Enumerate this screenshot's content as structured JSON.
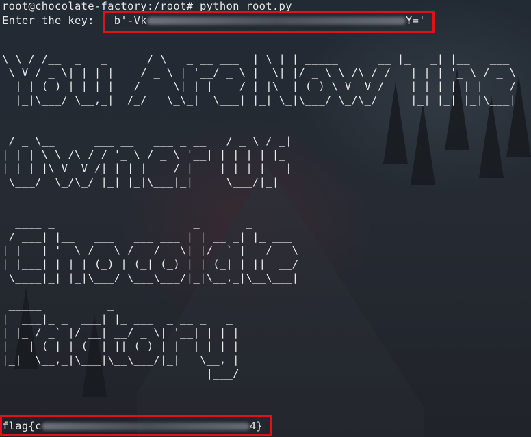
{
  "terminal": {
    "prompt": "root@chocolate-factory:/root# python root.py",
    "key_label": "Enter the key: ",
    "key_prefix": "b'-Vk",
    "key_suffix": "Y='",
    "banner_lines": [
      "__   __                 _               _   _                 _____ _          ",
      "\\ \\ / /__  _   _      / \\   _ __ ___  | \\ | | _____      __ |_   _| |__   ___ ",
      " \\ V / _ \\| | | |    / _ \\ | '__/ _ \\ |  \\| |/ _ \\ \\ /\\ / /   | | | '_ \\ / _ \\",
      "  | | (_) | |_| |   / ___ \\| | |  __/ | |\\  | (_) \\ V  V /    | | | | | |  __/",
      "  |_|\\___/ \\__,_|  /_/   \\_\\_|  \\___| |_| \\_|\\___/ \\_/\\_/     |_| |_| |_|\\___|",
      "",
      "  ___                              ___   __  ",
      " / _ \\__      ___ __   ___ _ __   / _ \\ / _| ",
      "| | | \\ \\ /\\ / / '_ \\ / _ \\ '__| | | | | |_  ",
      "| |_| |\\ V  V /| | | |  __/ |    | |_| |  _| ",
      " \\___/  \\_/\\_/ |_| |_|\\___|_|     \\___/|_|   ",
      "",
      "",
      "  ____ _                     _       _       ",
      " / ___| |__   ___   ___ ___ | | __ _| |_ ___ ",
      "| |   | '_ \\ / _ \\ / __/ _ \\| |/ _` | __/ _ \\",
      "| |___| | | | (_) | (_| (_) | | (_| | ||  __/",
      " \\____|_| |_|\\___/ \\___\\___/|_|\\__,_|\\__\\___|",
      "",
      " _____          _                    ",
      "|  ___|_ _  ___| |_ ___  _ __ _   _  ",
      "| |_ / _` |/ __| __/ _ \\| '__| | | | ",
      "|  _| (_| | (__| || (_) | |  | |_| | ",
      "|_|  \\__,_|\\___|\\__\\___/|_|   \\__, | ",
      "                               |___/  "
    ],
    "flag_prefix": "flag{c",
    "flag_suffix": "4}"
  },
  "colors": {
    "highlight": "#e0111b",
    "text": "#e8e8e8",
    "background": "#1f242c"
  }
}
